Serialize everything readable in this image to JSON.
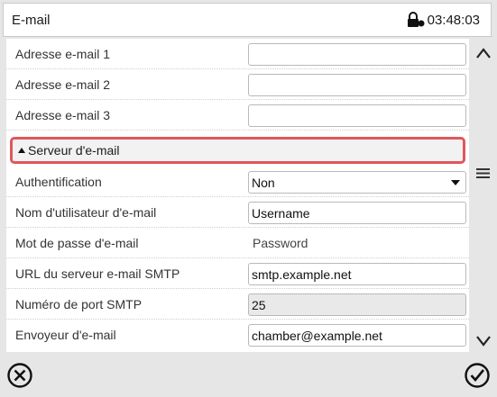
{
  "window": {
    "title": "E-mail",
    "time": "03:48:03"
  },
  "rows": {
    "addr1": {
      "label": "Adresse e-mail 1",
      "value": ""
    },
    "addr2": {
      "label": "Adresse e-mail 2",
      "value": ""
    },
    "addr3": {
      "label": "Adresse e-mail 3",
      "value": ""
    }
  },
  "section": {
    "title": "Serveur d'e-mail"
  },
  "server": {
    "auth": {
      "label": "Authentification",
      "value": "Non"
    },
    "username": {
      "label": "Nom d'utilisateur d'e-mail",
      "value": "Username"
    },
    "password": {
      "label": "Mot de passe d'e-mail",
      "value": "Password"
    },
    "smtp_url": {
      "label": "URL du serveur e-mail SMTP",
      "value": "smtp.example.net"
    },
    "smtp_port": {
      "label": "Numéro de port SMTP",
      "value": "25"
    },
    "sender": {
      "label": "Envoyeur d'e-mail",
      "value": "chamber@example.net"
    }
  },
  "colors": {
    "highlight": "#e0575c",
    "background": "#e6e6e6"
  },
  "icons": {
    "lock": "lock-icon",
    "up": "scroll-up-icon",
    "menu": "menu-icon",
    "down": "scroll-down-icon",
    "cancel": "cancel-icon",
    "confirm": "confirm-icon"
  }
}
